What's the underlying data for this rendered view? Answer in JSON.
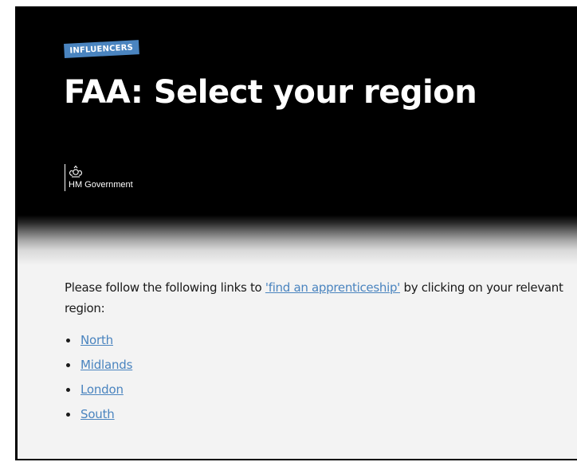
{
  "hero": {
    "tag": "INFLUENCERS",
    "title": "FAA: Select your region",
    "logo_text": "HM Government",
    "logo_icon": "royal-crest-icon"
  },
  "content": {
    "intro_before": "Please follow the following links to ",
    "intro_link": "'find an apprenticeship'",
    "intro_after": " by clicking on your relevant region:",
    "regions": [
      {
        "label": "North"
      },
      {
        "label": "Midlands"
      },
      {
        "label": "London"
      },
      {
        "label": "South"
      }
    ]
  },
  "colors": {
    "link": "#4a84bf",
    "tag_background": "#4a84bf",
    "hero_background": "#000000",
    "page_background": "#f3f3f3"
  }
}
